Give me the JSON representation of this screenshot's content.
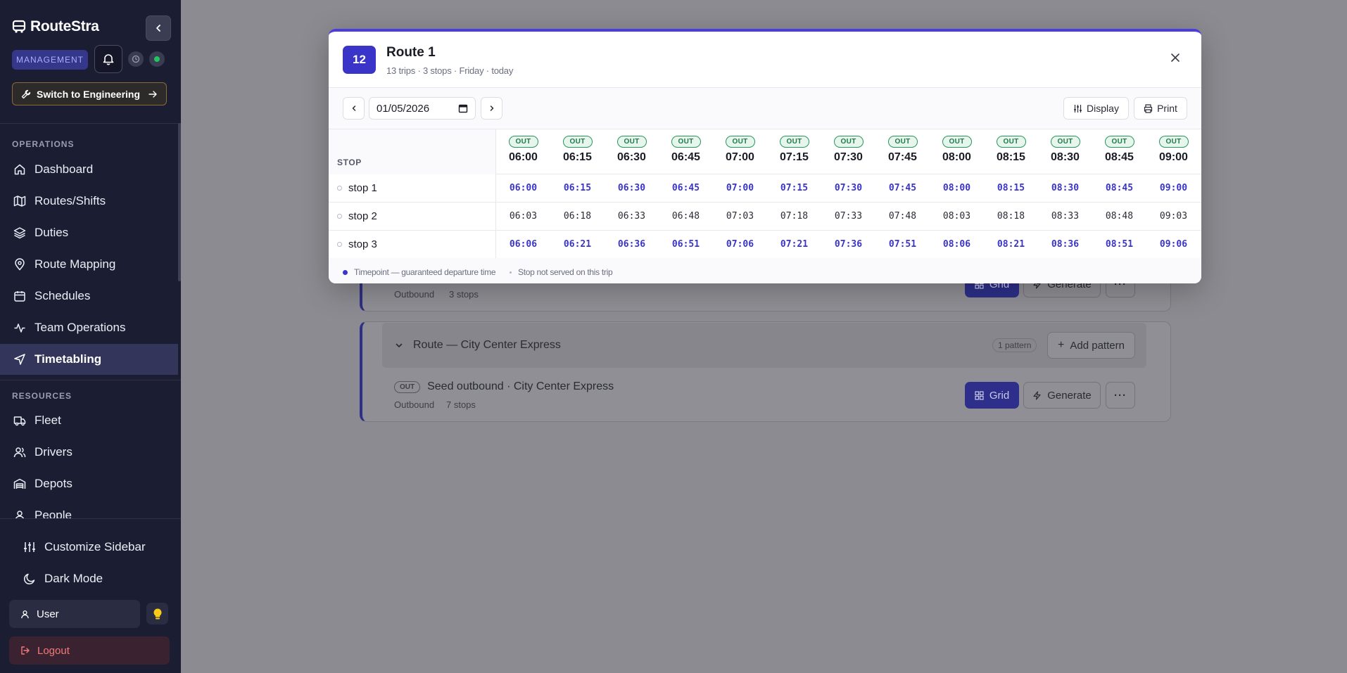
{
  "sidebar": {
    "brand": "RouteStra",
    "mode_badge": "MANAGEMENT",
    "switch_label": "Switch to Engineering",
    "sections": {
      "operations": "OPERATIONS",
      "resources": "RESOURCES"
    },
    "operations_items": [
      {
        "label": "Dashboard",
        "icon": "home-icon"
      },
      {
        "label": "Routes/Shifts",
        "icon": "map-icon"
      },
      {
        "label": "Duties",
        "icon": "layers-icon"
      },
      {
        "label": "Route Mapping",
        "icon": "map-pin-icon"
      },
      {
        "label": "Schedules",
        "icon": "calendar-icon"
      },
      {
        "label": "Team Operations",
        "icon": "activity-icon"
      },
      {
        "label": "Timetabling",
        "icon": "navigation-icon",
        "active": true
      }
    ],
    "resources_items": [
      {
        "label": "Fleet",
        "icon": "truck-icon"
      },
      {
        "label": "Drivers",
        "icon": "users-icon"
      },
      {
        "label": "Depots",
        "icon": "warehouse-icon"
      },
      {
        "label": "People",
        "icon": "people-icon"
      }
    ],
    "customize_label": "Customize Sidebar",
    "dark_mode_label": "Dark Mode",
    "user_label": "User",
    "logout_label": "Logout",
    "accent_colors": {
      "status_dot": "#22c55e",
      "bulb": "#facc15",
      "logout": "#f07a7a"
    }
  },
  "background": {
    "pattern_top": {
      "meta_direction": "Outbound",
      "meta_stops": "3 stops"
    },
    "route_city": {
      "title": "Route — City Center Express",
      "pattern_count": "1 pattern",
      "add_pattern_label": "Add pattern",
      "pattern": {
        "tag": "OUT",
        "name": "Seed outbound · City Center Express",
        "meta_direction": "Outbound",
        "meta_stops": "7 stops"
      }
    },
    "grid_label": "Grid",
    "generate_label": "Generate"
  },
  "modal": {
    "trip_count": "12",
    "title": "Route 1",
    "subtitle": "13 trips · 3 stops · Friday · today",
    "date_value": "01/05/2026",
    "display_label": "Display",
    "print_label": "Print",
    "stop_header": "STOP",
    "trips": [
      {
        "dir": "OUT",
        "time": "06:00"
      },
      {
        "dir": "OUT",
        "time": "06:15"
      },
      {
        "dir": "OUT",
        "time": "06:30"
      },
      {
        "dir": "OUT",
        "time": "06:45"
      },
      {
        "dir": "OUT",
        "time": "07:00"
      },
      {
        "dir": "OUT",
        "time": "07:15"
      },
      {
        "dir": "OUT",
        "time": "07:30"
      },
      {
        "dir": "OUT",
        "time": "07:45"
      },
      {
        "dir": "OUT",
        "time": "08:00"
      },
      {
        "dir": "OUT",
        "time": "08:15"
      },
      {
        "dir": "OUT",
        "time": "08:30"
      },
      {
        "dir": "OUT",
        "time": "08:45"
      },
      {
        "dir": "OUT",
        "time": "09:00"
      }
    ],
    "stops": [
      {
        "name": "stop 1",
        "timepoint": true,
        "times": [
          "06:00",
          "06:15",
          "06:30",
          "06:45",
          "07:00",
          "07:15",
          "07:30",
          "07:45",
          "08:00",
          "08:15",
          "08:30",
          "08:45",
          "09:00"
        ]
      },
      {
        "name": "stop 2",
        "timepoint": false,
        "times": [
          "06:03",
          "06:18",
          "06:33",
          "06:48",
          "07:03",
          "07:18",
          "07:33",
          "07:48",
          "08:03",
          "08:18",
          "08:33",
          "08:48",
          "09:03"
        ]
      },
      {
        "name": "stop 3",
        "timepoint": true,
        "times": [
          "06:06",
          "06:21",
          "06:36",
          "06:51",
          "07:06",
          "07:21",
          "07:36",
          "07:51",
          "08:06",
          "08:21",
          "08:36",
          "08:51",
          "09:06"
        ]
      }
    ],
    "legend": {
      "timepoint": "Timepoint — guaranteed departure time",
      "not_served": "Stop not served on this trip"
    },
    "colors": {
      "accent": "#3a34c9",
      "out_badge": "#27955b"
    }
  }
}
